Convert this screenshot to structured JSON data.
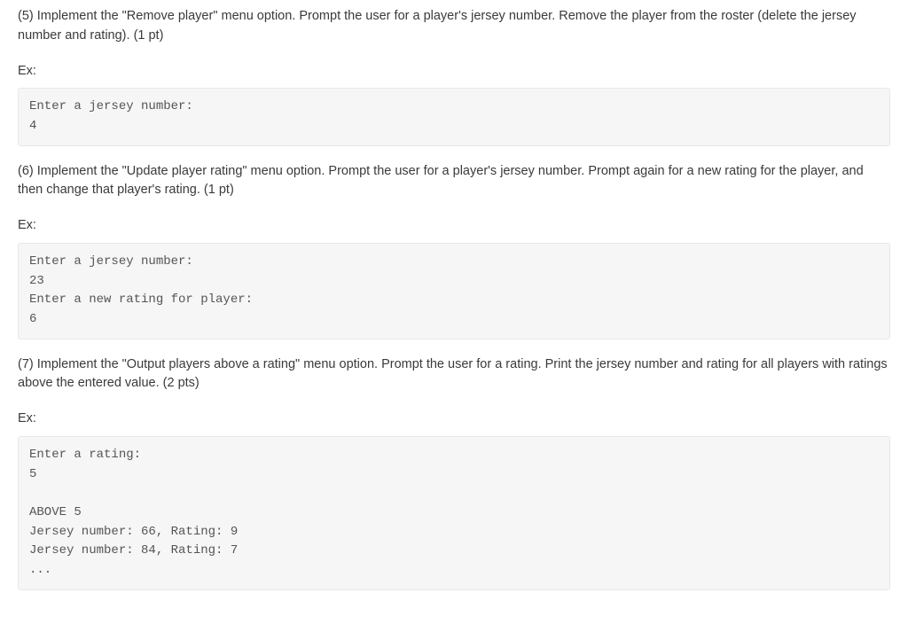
{
  "sections": [
    {
      "paragraph": "(5) Implement the \"Remove player\" menu option. Prompt the user for a player's jersey number. Remove the player from the roster (delete the jersey number and rating). (1 pt)",
      "ex_label": "Ex:",
      "code": "Enter a jersey number:\n4"
    },
    {
      "paragraph": "(6) Implement the \"Update player rating\" menu option. Prompt the user for a player's jersey number. Prompt again for a new rating for the player, and then change that player's rating. (1 pt)",
      "ex_label": "Ex:",
      "code": "Enter a jersey number:\n23\nEnter a new rating for player:\n6"
    },
    {
      "paragraph": "(7) Implement the \"Output players above a rating\" menu option. Prompt the user for a rating. Print the jersey number and rating for all players with ratings above the entered value. (2 pts)",
      "ex_label": "Ex:",
      "code": "Enter a rating:\n5\n\nABOVE 5\nJersey number: 66, Rating: 9\nJersey number: 84, Rating: 7\n..."
    }
  ]
}
